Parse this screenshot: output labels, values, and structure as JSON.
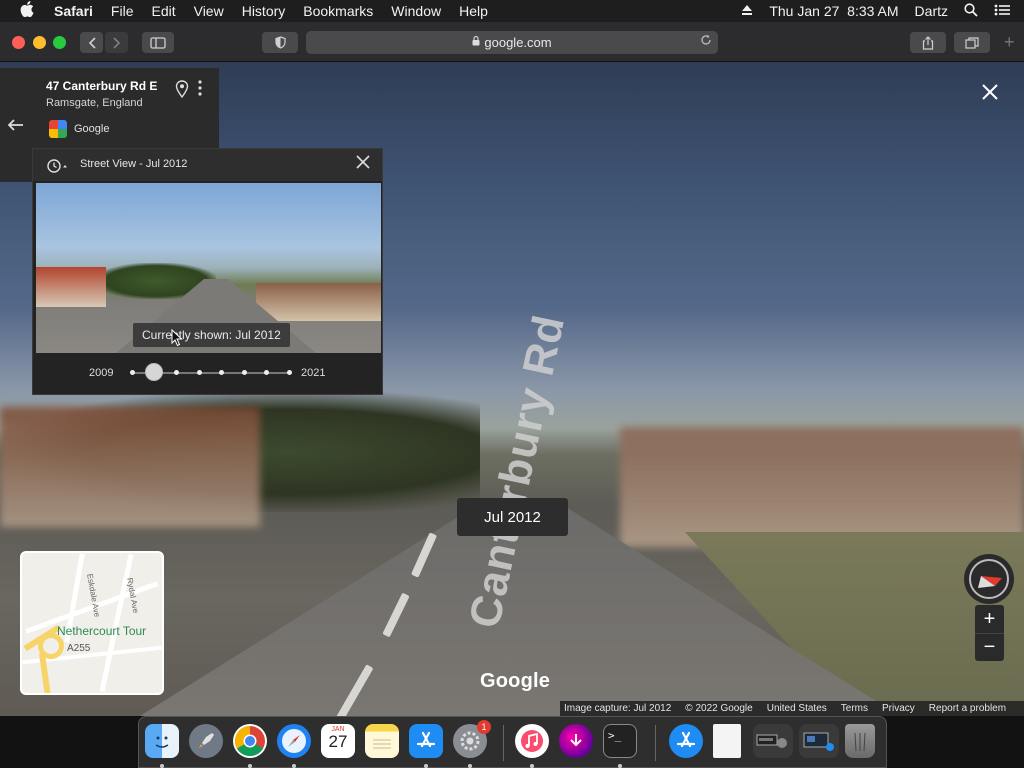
{
  "menubar": {
    "app_name": "Safari",
    "items": [
      "File",
      "Edit",
      "View",
      "History",
      "Bookmarks",
      "Window",
      "Help"
    ],
    "clock": "Thu Jan 27  8:33 AM",
    "user": "Dartz"
  },
  "toolbar": {
    "url": "google.com"
  },
  "address_card": {
    "title": "47 Canterbury Rd E",
    "subtitle": "Ramsgate, England",
    "source": "Google"
  },
  "street_view_panel": {
    "title": "Street View - Jul 2012",
    "tooltip": "Currently shown: Jul 2012",
    "year_start": "2009",
    "year_end": "2021",
    "slider_positions": 8,
    "selected_index": 1
  },
  "date_pill": "Jul 2012",
  "road_name": "Canterbury Rd",
  "minimap": {
    "place_label": "Nethercourt Tour",
    "road_label": "A255",
    "street_1": "Eskdale Ave",
    "street_2": "Rydal Ave"
  },
  "google_wordmark": "Google",
  "footer": {
    "image_capture": "Image capture: Jul 2012",
    "copyright": "© 2022 Google",
    "region": "United States",
    "terms": "Terms",
    "privacy": "Privacy",
    "report": "Report a problem"
  },
  "dock": {
    "calendar_month": "JAN",
    "calendar_day": "27",
    "settings_badge": "1"
  },
  "colors": {
    "panel_bg": "#232323",
    "accent_red": "#e23b2e",
    "map_green": "#2e8b57"
  }
}
